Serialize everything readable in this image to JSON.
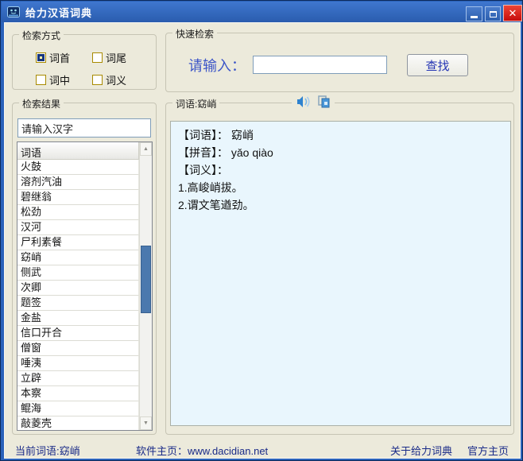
{
  "window": {
    "title": "给力汉语词典"
  },
  "icons": {
    "app": "dictionary-book-icon",
    "speaker": "speaker-icon",
    "copy": "copy-pages-icon",
    "scroll_up": "▲",
    "scroll_down": "▼",
    "minimize": "─",
    "maximize": "□",
    "close": "✕"
  },
  "colors": {
    "titlebar_blue": "#2f63b5",
    "frame_blue": "#2a62ba",
    "close_red": "#d31010",
    "client_bg": "#eceadb",
    "definition_bg": "#e9f6fd",
    "status_text_navy": "#1a2b88",
    "link_text_blue": "#2636b4",
    "prompt_blue": "#3c55c8",
    "checkbox_gold": "#a88a00",
    "scroll_thumb_blue": "#4b79ae"
  },
  "search_mode": {
    "legend": "检索方式",
    "options": [
      {
        "label": "词首",
        "checked": true
      },
      {
        "label": "词尾",
        "checked": false
      },
      {
        "label": "词中",
        "checked": false
      },
      {
        "label": "词义",
        "checked": false
      }
    ]
  },
  "quick_search": {
    "legend": "快速检索",
    "prompt": "请输入：",
    "input_value": "",
    "find_button": "查找"
  },
  "results": {
    "legend": "检索结果",
    "filter_value": "请输入汉字",
    "column_header": "词语",
    "items": [
      "火鼓",
      "溶剂汽油",
      "碧继翁",
      "松劲",
      "汉河",
      "尸利素餐",
      "窈峭",
      "侧武",
      "次卿",
      "题签",
      "金盐",
      "信口开合",
      "僧窗",
      "唾洟",
      "立辟",
      "本察",
      "鲲海",
      "敲菱壳"
    ]
  },
  "definition": {
    "legend": "词语:窈峭",
    "lines": [
      "【词语】： 窈峭",
      "【拼音】： yǎo qiào",
      "【词义】：",
      "1.高峻峭拔。",
      "2.谓文笔遒劲。"
    ]
  },
  "status_bar": {
    "current_word": "当前词语:窈峭",
    "homepage": "软件主页：www.dacidian.net",
    "about_link": "关于给力词典",
    "official_link": "官方主页"
  }
}
